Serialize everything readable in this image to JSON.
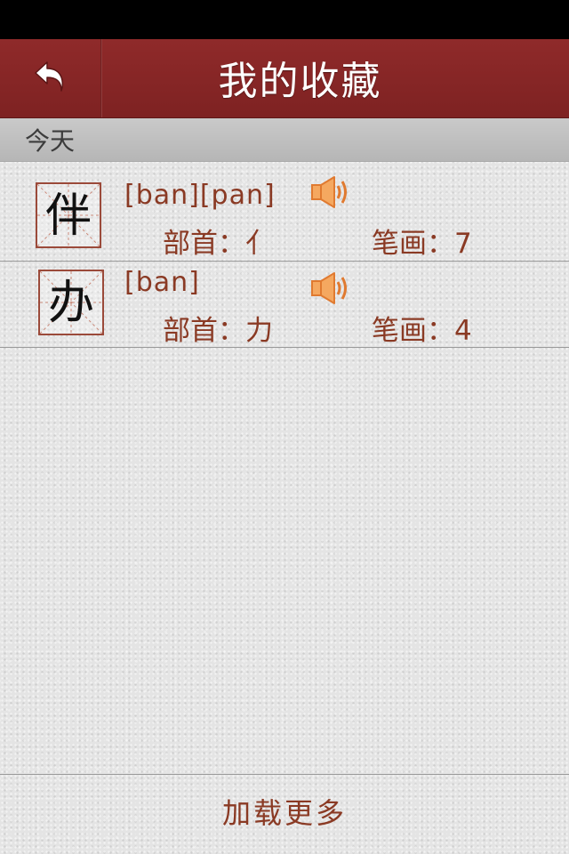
{
  "nav": {
    "title": "我的收藏",
    "back_icon": "back-arrow-icon",
    "bg_color": "#862626"
  },
  "section": {
    "label": "今天"
  },
  "entries": [
    {
      "character": "伴",
      "pinyin": "[ban][pan]",
      "radical_label": "部首：",
      "radical": "亻",
      "strokes_label": "笔画：",
      "strokes": "7",
      "sound_icon": "speaker-icon"
    },
    {
      "character": "办",
      "pinyin": "[ban]",
      "radical_label": "部首：",
      "radical": "力",
      "strokes_label": "笔画：",
      "strokes": "4",
      "sound_icon": "speaker-icon"
    }
  ],
  "footer": {
    "load_more": "加载更多"
  },
  "colors": {
    "accent_text": "#8a3a24",
    "speaker": "#f5a860"
  }
}
